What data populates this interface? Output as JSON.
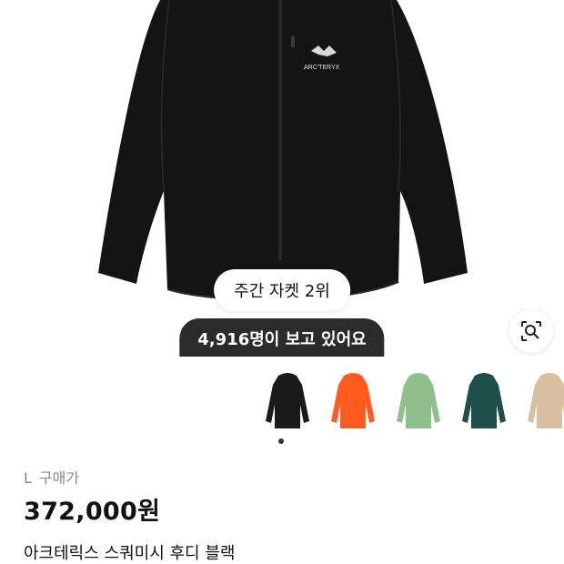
{
  "hero": {
    "rank_badge": "주간 자켓 2위",
    "viewers_badge": "4,916명이 보고 있어요",
    "brand_logo_text": "ARC'TERYX",
    "lens_icon": "lens-search-icon"
  },
  "thumbnails": [
    {
      "name": "black",
      "color": "#1a1a1a"
    },
    {
      "name": "orange",
      "color": "#ff5a1f"
    },
    {
      "name": "sage",
      "color": "#8fbf8a"
    },
    {
      "name": "teal",
      "color": "#1f4f4a"
    },
    {
      "name": "tan",
      "color": "#d9bfa0"
    }
  ],
  "product": {
    "size": "L",
    "price_label": "구매가",
    "price": "372,000원",
    "name": "아크테릭스 스쿼미시 후디 블랙"
  }
}
